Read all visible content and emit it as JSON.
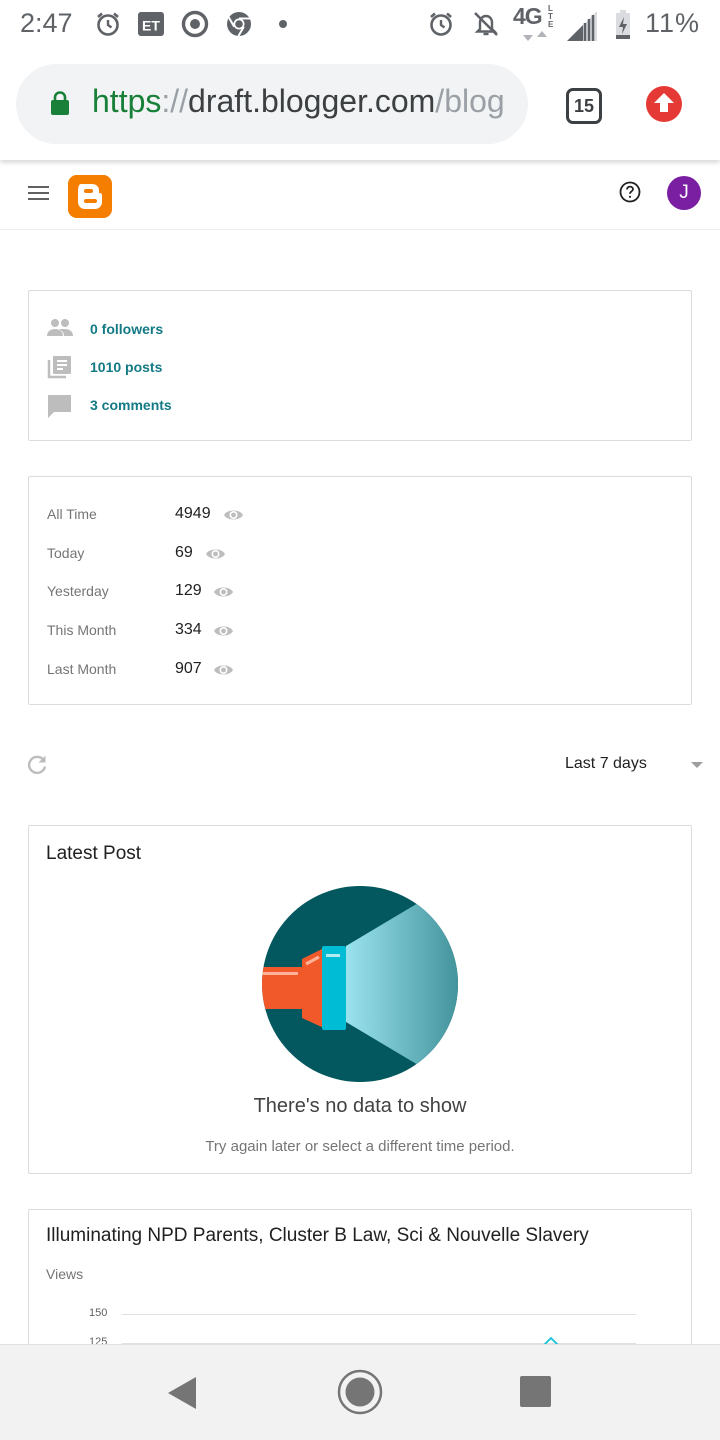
{
  "status_bar": {
    "time": "2:47",
    "network": "4G",
    "network_sub": "LTE",
    "battery": "11%",
    "icons": [
      "alarm-icon",
      "et-app-icon",
      "circle-app-icon",
      "chrome-icon",
      "dot-icon",
      "alarm-icon",
      "notifications-off-icon",
      "signal-icon",
      "battery-charging-icon"
    ]
  },
  "browser": {
    "url_scheme": "https",
    "url_separator": "://",
    "url_host": "draft.blogger.com",
    "url_path": "/blog",
    "tab_count": "15",
    "colors": {
      "secure": "#188038",
      "upload": "#e53935"
    }
  },
  "header": {
    "logo": "blogger-logo",
    "avatar_initial": "J",
    "colors": {
      "logo": "#f57d00",
      "avatar": "#7b1fa2"
    }
  },
  "stats": [
    {
      "icon": "people-icon",
      "text": "0 followers"
    },
    {
      "icon": "posts-icon",
      "text": "1010 posts"
    },
    {
      "icon": "comment-icon",
      "text": "3 comments"
    }
  ],
  "pageviews": [
    {
      "label": "All Time",
      "value": "4949"
    },
    {
      "label": "Today",
      "value": "69"
    },
    {
      "label": "Yesterday",
      "value": "129"
    },
    {
      "label": "This Month",
      "value": "334"
    },
    {
      "label": "Last Month",
      "value": "907"
    }
  ],
  "toolbar": {
    "range_selected": "Last 7 days"
  },
  "latest_post": {
    "title": "Latest Post",
    "empty_title": "There's no data to show",
    "empty_subtitle": "Try again later or select a different time period."
  },
  "blog_chart": {
    "title": "Illuminating NPD Parents, Cluster B Law, Sci & Nouvelle Slavery",
    "ylabel": "Views",
    "yticks": [
      "150",
      "125"
    ]
  },
  "nav": {
    "icons": [
      "back-icon",
      "home-icon",
      "recents-icon"
    ]
  }
}
